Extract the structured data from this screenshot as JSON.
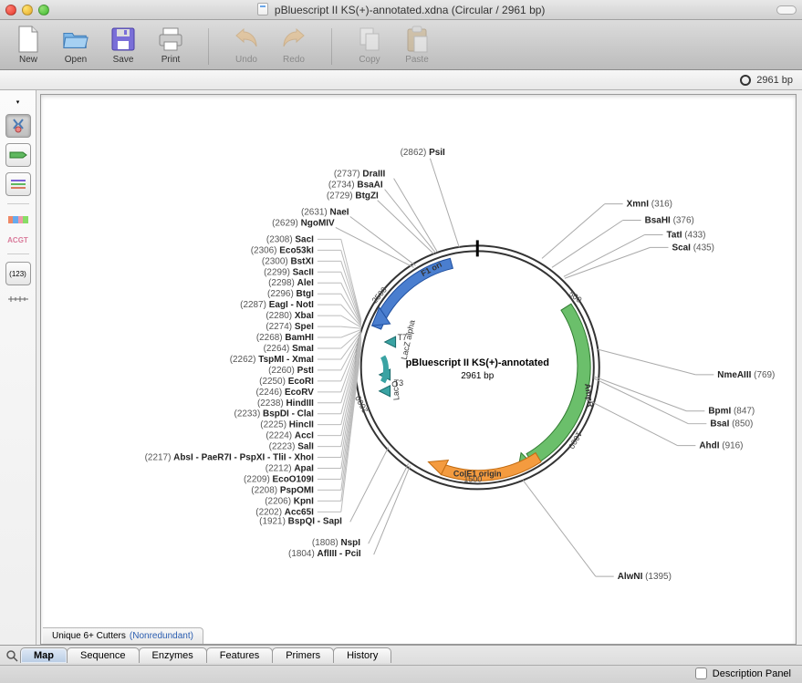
{
  "window": {
    "title": "pBluescript II KS(+)-annotated.xdna  (Circular / 2961 bp)"
  },
  "toolbar": {
    "new": "New",
    "open": "Open",
    "save": "Save",
    "print": "Print",
    "undo": "Undo",
    "redo": "Redo",
    "copy": "Copy",
    "paste": "Paste"
  },
  "infobar": {
    "length": "2961 bp"
  },
  "sidebar": {
    "acgt": "ACGT",
    "num": "(123)"
  },
  "plasmid": {
    "name": "pBluescript II KS(+)-annotated",
    "size": "2961 bp",
    "ticks": [
      "500",
      "1000",
      "1500",
      "2000",
      "2500"
    ],
    "features": {
      "f1ori": "F1 ori",
      "ampr": "AmpR",
      "cole1": "ColE1 origin",
      "t7": "T7",
      "t3": "T3",
      "lacz": "LacZ alpha",
      "laco": "LacO"
    },
    "sites_right": [
      {
        "pos": "(316)",
        "name": "XmnI"
      },
      {
        "pos": "(376)",
        "name": "BsaHI"
      },
      {
        "pos": "(433)",
        "name": "TatI"
      },
      {
        "pos": "(435)",
        "name": "ScaI"
      },
      {
        "pos": "(769)",
        "name": "NmeAIII"
      },
      {
        "pos": "(847)",
        "name": "BpmI"
      },
      {
        "pos": "(850)",
        "name": "BsaI"
      },
      {
        "pos": "(916)",
        "name": "AhdI"
      },
      {
        "pos": "(1395)",
        "name": "AlwNI"
      }
    ],
    "sites_top": [
      {
        "pos": "(2862)",
        "name": "PsiI"
      },
      {
        "pos": "(2737)",
        "name": "DraIII"
      },
      {
        "pos": "(2734)",
        "name": "BsaAI"
      },
      {
        "pos": "(2729)",
        "name": "BtgZI"
      },
      {
        "pos": "(2631)",
        "name": "NaeI"
      },
      {
        "pos": "(2629)",
        "name": "NgoMIV"
      }
    ],
    "sites_left": [
      {
        "pos": "(2308)",
        "name": "SacI"
      },
      {
        "pos": "(2306)",
        "name": "Eco53kI"
      },
      {
        "pos": "(2300)",
        "name": "BstXI"
      },
      {
        "pos": "(2299)",
        "name": "SacII"
      },
      {
        "pos": "(2298)",
        "name": "AleI"
      },
      {
        "pos": "(2296)",
        "name": "BtgI"
      },
      {
        "pos": "(2287)",
        "name": "EagI - NotI"
      },
      {
        "pos": "(2280)",
        "name": "XbaI"
      },
      {
        "pos": "(2274)",
        "name": "SpeI"
      },
      {
        "pos": "(2268)",
        "name": "BamHI"
      },
      {
        "pos": "(2264)",
        "name": "SmaI"
      },
      {
        "pos": "(2262)",
        "name": "TspMI - XmaI"
      },
      {
        "pos": "(2260)",
        "name": "PstI"
      },
      {
        "pos": "(2250)",
        "name": "EcoRI"
      },
      {
        "pos": "(2246)",
        "name": "EcoRV"
      },
      {
        "pos": "(2238)",
        "name": "HindIII"
      },
      {
        "pos": "(2233)",
        "name": "BspDI - ClaI"
      },
      {
        "pos": "(2225)",
        "name": "HincII"
      },
      {
        "pos": "(2224)",
        "name": "AccI"
      },
      {
        "pos": "(2223)",
        "name": "SalI"
      },
      {
        "pos": "(2217)",
        "name": "AbsI - PaeR7I - PspXI - TliI - XhoI"
      },
      {
        "pos": "(2212)",
        "name": "ApaI"
      },
      {
        "pos": "(2209)",
        "name": "EcoO109I"
      },
      {
        "pos": "(2208)",
        "name": "PspOMI"
      },
      {
        "pos": "(2206)",
        "name": "KpnI"
      },
      {
        "pos": "(2202)",
        "name": "Acc65I"
      }
    ],
    "sites_bottom": [
      {
        "pos": "(1921)",
        "name": "BspQI - SapI"
      },
      {
        "pos": "(1808)",
        "name": "NspI"
      },
      {
        "pos": "(1804)",
        "name": "AflIII - PciI"
      }
    ]
  },
  "cutterTab": {
    "label": "Unique 6+ Cutters",
    "mode": "(Nonredundant)"
  },
  "tabs": {
    "map": "Map",
    "sequence": "Sequence",
    "enzymes": "Enzymes",
    "features": "Features",
    "primers": "Primers",
    "history": "History"
  },
  "descriptionPanel": "Description Panel"
}
